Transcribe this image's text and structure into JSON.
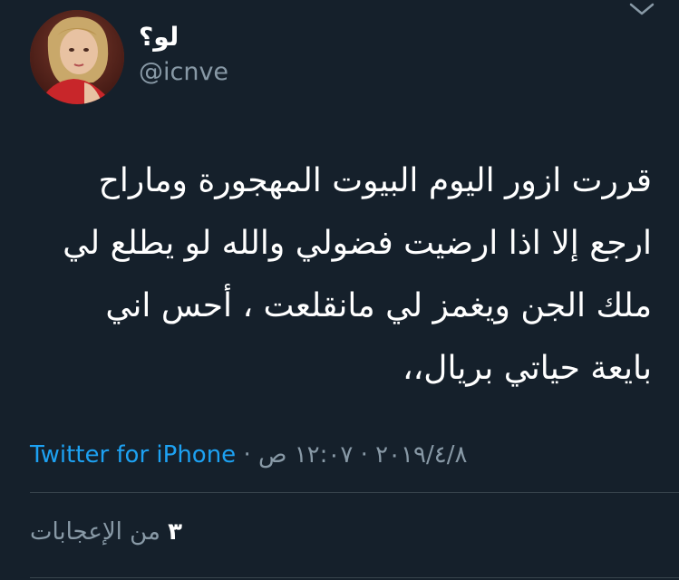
{
  "tweet": {
    "author": {
      "display_name": "لو؟",
      "handle": "@icnve",
      "avatar": "user-avatar-photo"
    },
    "menu_icon": "chevron-down-icon",
    "text": "قررت ازور اليوم البيوت المهجورة وماراح\nارجع إلا اذا ارضيت فضولي والله لو يطلع لي\nملك الجن ويغمز لي مانقلعت ، أحس اني\nبايعة حياتي بريال،،",
    "time": "١٢:٠٧ ص",
    "date": "٢٠١٩/٤/٨",
    "separator": "·",
    "source": "Twitter for iPhone",
    "likes": {
      "count": "٣",
      "label": "من الإعجابات"
    }
  },
  "colors": {
    "background": "#15202b",
    "text_primary": "#ffffff",
    "text_secondary": "#8899a6",
    "link": "#1da1f2",
    "divider": "#38444d"
  }
}
